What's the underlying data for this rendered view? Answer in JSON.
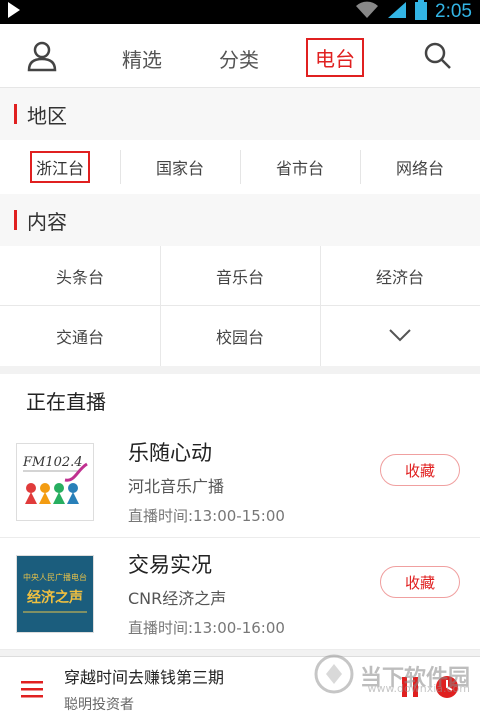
{
  "status_bar": {
    "time": "2:05"
  },
  "nav": {
    "tabs": [
      {
        "label": "精选"
      },
      {
        "label": "分类"
      },
      {
        "label": "电台"
      }
    ],
    "active_tab": "电台"
  },
  "region": {
    "heading": "地区",
    "items": [
      "浙江台",
      "国家台",
      "省市台",
      "网络台"
    ],
    "selected": "浙江台"
  },
  "content": {
    "heading": "内容",
    "rows": [
      [
        "头条台",
        "音乐台",
        "经济台"
      ],
      [
        "交通台",
        "校园台",
        ""
      ]
    ]
  },
  "live": {
    "heading": "正在直播",
    "items": [
      {
        "name": "乐随心动",
        "station": "河北音乐广播",
        "time": "直播时间:13:00-15:00",
        "fav_label": "收藏",
        "logo_text": "FM102.4"
      },
      {
        "name": "交易实况",
        "station": "CNR经济之声",
        "time": "直播时间:13:00-16:00",
        "fav_label": "收藏",
        "logo_text": "中央人民广播电台 经济之声"
      }
    ]
  },
  "player": {
    "title": "穿越时间去赚钱第三期",
    "author": "聪明投资者"
  },
  "watermark": {
    "text": "当下软件园",
    "url": "www.downxia.com"
  },
  "colors": {
    "accent": "#e02020",
    "status_bar": "#000000",
    "status_icons": "#33b5e5"
  }
}
